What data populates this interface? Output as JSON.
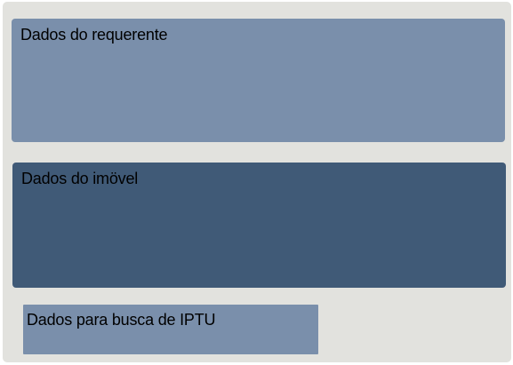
{
  "sections": {
    "requerente": {
      "label": "Dados do requerente",
      "color": "#7a8fab"
    },
    "imovel": {
      "label": "Dados do imövel",
      "color": "#405a77"
    },
    "iptu": {
      "label": "Dados para busca de IPTU",
      "color": "#7a8fab"
    }
  },
  "colors": {
    "frame_background": "#e2e2de",
    "text": "#000000"
  }
}
